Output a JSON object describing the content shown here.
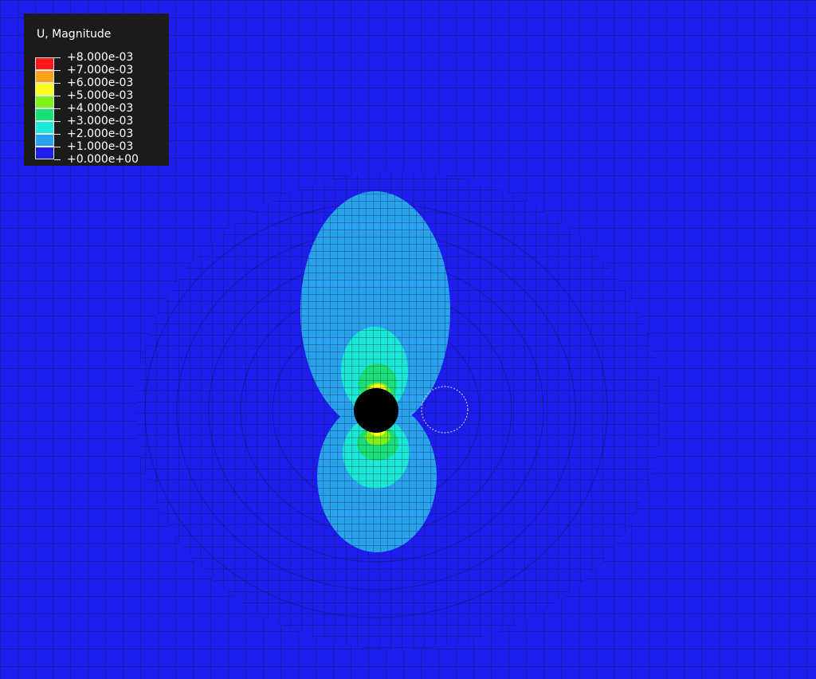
{
  "legend": {
    "title": "U, Magnitude",
    "colors": [
      "#ff1a1a",
      "#ffa31a",
      "#ffff1a",
      "#7ef01a",
      "#1ae07a",
      "#1ae8d8",
      "#29a3ef",
      "#1d1dee"
    ],
    "levels": [
      "+8.000e-03",
      "+7.000e-03",
      "+6.000e-03",
      "+5.000e-03",
      "+4.000e-03",
      "+3.000e-03",
      "+2.000e-03",
      "+1.000e-03",
      "+0.000e+00"
    ]
  },
  "viewport": {
    "background_color": "#1d1dee",
    "mesh_line_color": "#111111",
    "hole_color": "#000000"
  }
}
